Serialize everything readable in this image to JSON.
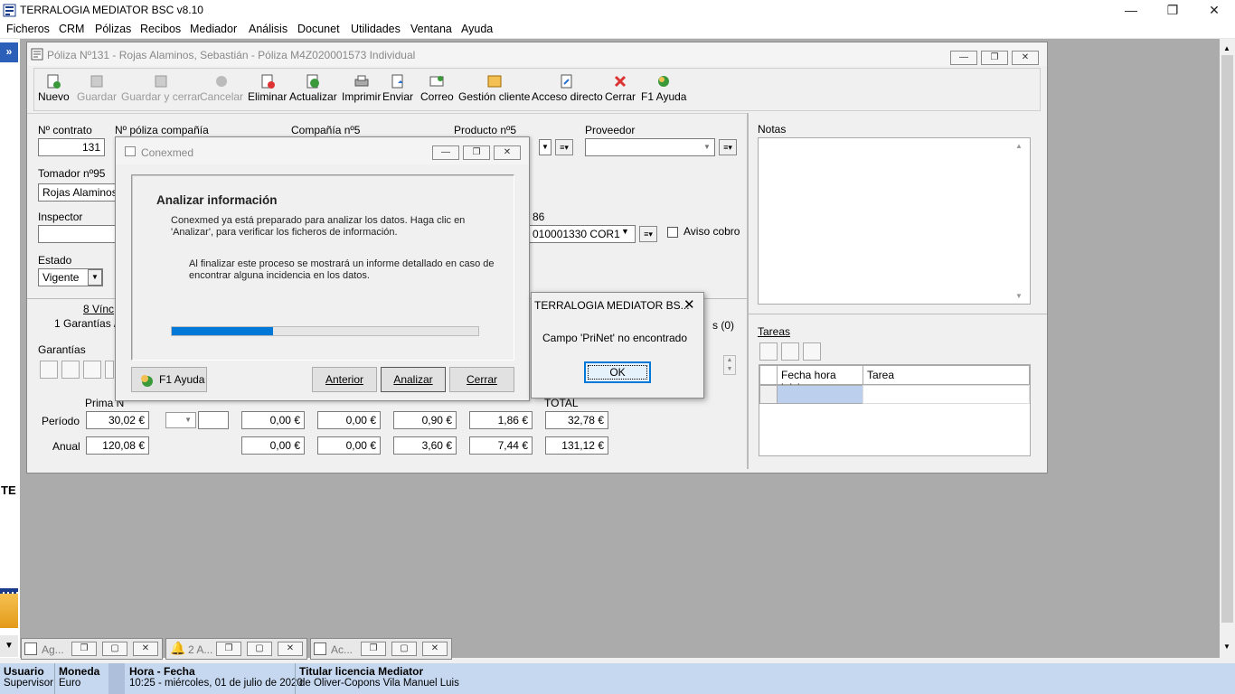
{
  "app_title": "TERRALOGIA MEDIATOR BSC v8.10",
  "menu": [
    "Ficheros",
    "CRM",
    "Pólizas",
    "Recibos",
    "Mediador",
    "Análisis",
    "Docunet",
    "Utilidades",
    "Ventana",
    "Ayuda"
  ],
  "child_title": "Póliza Nº131 - Rojas Alaminos, Sebastián - Póliza M4Z020001573 Individual",
  "toolbar": {
    "nuevo": "Nuevo",
    "guardar": "Guardar",
    "guardar_cerrar": "Guardar y cerrar",
    "cancelar": "Cancelar",
    "eliminar": "Eliminar",
    "actualizar": "Actualizar",
    "imprimir": "Imprimir",
    "enviar": "Enviar",
    "correo": "Correo",
    "gestion": "Gestión cliente",
    "acceso": "Acceso directo",
    "cerrar": "Cerrar",
    "ayuda": "F1 Ayuda"
  },
  "form": {
    "n_contrato_label": "Nº contrato",
    "n_contrato": "131",
    "n_poliza_label": "Nº póliza compañía",
    "compania_label": "Compañía nº5",
    "producto_label": "Producto nº5",
    "proveedor_label": "Proveedor",
    "tomador_label": "Tomador nº95",
    "tomador": "Rojas Alaminos, S",
    "inspector_label": "Inspector",
    "estado_label": "Estado",
    "estado": "Vigente",
    "cuenta_label": "86",
    "cuenta": "010001330 COR1",
    "aviso_cobro": "Aviso cobro",
    "notas_label": "Notas",
    "tab1": "8 Vínc",
    "tab2": "1 Garantías /",
    "tab3": "s (0)",
    "garantias_label": "Garantías",
    "prima_label": "Prima N",
    "total_label": "TOTAL",
    "periodo_label": "Período",
    "anual_label": "Anual",
    "periodo": [
      "30,02 €",
      "0,00 €",
      "0,00 €",
      "0,90 €",
      "1,86 €",
      "32,78 €"
    ],
    "anual": [
      "120,08 €",
      "0,00 €",
      "0,00 €",
      "3,60 €",
      "7,44 €",
      "131,12 €"
    ],
    "tareas_label": "Tareas",
    "col_fecha": "Fecha hora inicio",
    "col_tarea": "Tarea"
  },
  "conexmed": {
    "title": "Conexmed",
    "heading": "Analizar información",
    "p1": "Conexmed ya está preparado para analizar los datos. Haga clic en 'Analizar', para verificar los ficheros de información.",
    "p2": "Al finalizar este proceso se mostrará un informe detallado en caso de encontrar alguna incidencia en los datos.",
    "progress": 0.33,
    "help": "F1 Ayuda",
    "anterior": "Anterior",
    "analizar": "Analizar",
    "cerrar": "Cerrar"
  },
  "msgbox": {
    "title": "TERRALOGIA MEDIATOR BS...",
    "text": "Campo 'PriNet' no encontrado",
    "ok": "OK"
  },
  "left_cut": "TE",
  "minimized": [
    "Ag...",
    "2 A...",
    "Ac..."
  ],
  "status": {
    "usuario_h": "Usuario",
    "usuario": "Supervisor",
    "moneda_h": "Moneda",
    "moneda": "Euro",
    "hora_h": "Hora - Fecha",
    "hora": "10:25 - miércoles, 01 de julio de 2020",
    "titular_h": "Titular licencia Mediator",
    "titular": "de Oliver-Copons Vila Manuel Luis"
  },
  "colors": {
    "accent": "#0078d7",
    "status_bg": "#c6d8f0",
    "mdi_bg": "#ababab"
  }
}
